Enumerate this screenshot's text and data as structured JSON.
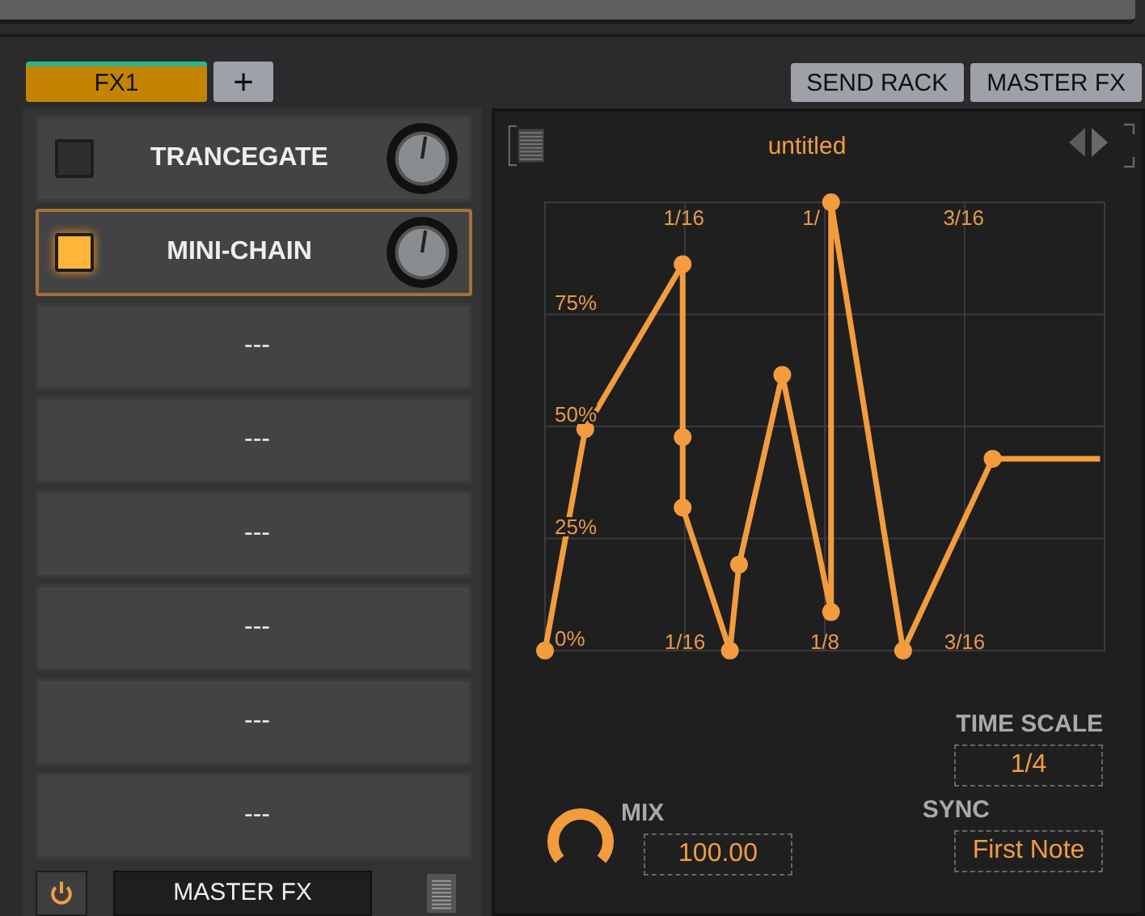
{
  "tabs": [
    {
      "label": "FX1",
      "selected": true
    },
    {
      "label": "+",
      "selected": false
    }
  ],
  "rack_buttons": [
    "SEND RACK",
    "MASTER FX"
  ],
  "slots": [
    {
      "kind": "effect",
      "name": "TRANCEGATE",
      "on": false,
      "selected": false
    },
    {
      "kind": "effect",
      "name": "MINI-CHAIN",
      "on": true,
      "selected": true
    },
    {
      "kind": "empty",
      "name": "---"
    },
    {
      "kind": "empty",
      "name": "---"
    },
    {
      "kind": "empty",
      "name": "---"
    },
    {
      "kind": "empty",
      "name": "---"
    },
    {
      "kind": "empty",
      "name": "---"
    },
    {
      "kind": "empty",
      "name": "---"
    }
  ],
  "footer": {
    "power_on": true,
    "button": "MASTER FX"
  },
  "editor": {
    "title": "untitled",
    "top_labels": [
      "1/16",
      "1/",
      "3/16"
    ],
    "chart_data": {
      "type": "line",
      "xlim": [
        0,
        0.25
      ],
      "ylim": [
        0,
        1
      ],
      "grid": true,
      "x": [
        0,
        0.018,
        0.0615,
        0.0615,
        0.0615,
        0.0826,
        0.0867,
        0.106,
        0.1278,
        0.1278,
        0.16,
        0.2,
        0.248
      ],
      "series": [
        {
          "color": "#f29c3e",
          "marker": "circle",
          "values": [
            0,
            0.494,
            0.862,
            0.476,
            0.319,
            0,
            0.192,
            0.615,
            0.086,
            1,
            0,
            0.428,
            0.428
          ]
        }
      ],
      "xticks": [
        {
          "value": 0.0625,
          "label": "1/16"
        },
        {
          "value": 0.125,
          "label": "1/8"
        },
        {
          "value": 0.1875,
          "label": "3/16"
        }
      ],
      "yticks": [
        {
          "value": 0,
          "label": "0%"
        },
        {
          "value": 0.25,
          "label": "25%"
        },
        {
          "value": 0.5,
          "label": "50%"
        },
        {
          "value": 0.75,
          "label": "75%"
        }
      ]
    },
    "time_scale": {
      "label": "TIME SCALE",
      "value": "1/4"
    },
    "mix": {
      "label": "MIX",
      "value": "100.00"
    },
    "sync": {
      "label": "SYNC",
      "value": "First Note"
    }
  }
}
